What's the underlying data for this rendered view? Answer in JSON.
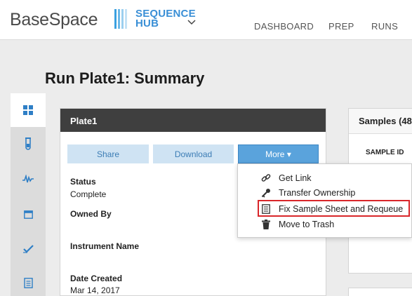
{
  "header": {
    "brand": "BaseSpace",
    "hub_line1": "SEQUENCE",
    "hub_line2": "HUB",
    "nav": [
      "DASHBOARD",
      "PREP",
      "RUNS"
    ]
  },
  "page": {
    "title": "Run Plate1: Summary"
  },
  "sidebar": {
    "items": [
      {
        "icon": "grid-icon",
        "active": true
      },
      {
        "icon": "tube-icon",
        "active": false
      },
      {
        "icon": "waveform-icon",
        "active": false
      },
      {
        "icon": "calendar-icon",
        "active": false
      },
      {
        "icon": "check-icon",
        "active": false
      },
      {
        "icon": "document-icon",
        "active": false
      }
    ]
  },
  "plate_panel": {
    "title": "Plate1",
    "buttons": {
      "share": "Share",
      "download": "Download",
      "more": "More ▾"
    },
    "fields": {
      "status_label": "Status",
      "status_value": "Complete",
      "owned_by_label": "Owned By",
      "instrument_label": "Instrument Name",
      "date_label": "Date Created",
      "date_value": "Mar 14, 2017"
    }
  },
  "samples_panel": {
    "title": "Samples (48",
    "column": "SAMPLE ID"
  },
  "more_menu": {
    "items": [
      {
        "label": "Get Link",
        "icon": "link-icon"
      },
      {
        "label": "Transfer Ownership",
        "icon": "key-icon"
      },
      {
        "label": "Fix Sample Sheet and Requeue",
        "icon": "sample-sheet-icon",
        "highlighted": true
      },
      {
        "label": "Move to Trash",
        "icon": "trash-icon"
      }
    ]
  },
  "colors": {
    "accent": "#3a8fd6",
    "button_light": "#cfe3f3",
    "button_active": "#5aa3dc",
    "panel_header": "#3f3f3f",
    "highlight_border": "#d9262a"
  }
}
